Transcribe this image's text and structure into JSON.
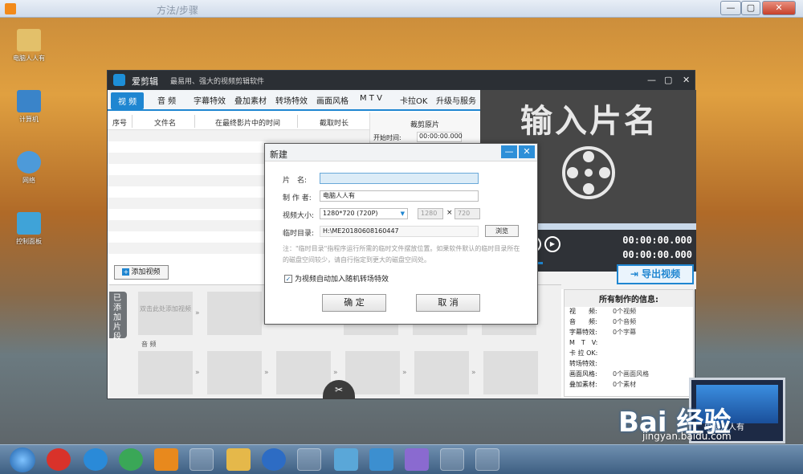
{
  "outer_window": {
    "blurred_title": "方法/步骤"
  },
  "desktop_icons": [
    "电脑人人有",
    "计算机",
    "网络",
    "控制面板"
  ],
  "app": {
    "name": "爱剪辑",
    "slogan": "最易用、强大的视频剪辑软件",
    "tabs": [
      "视 频",
      "音 频",
      "字幕特效",
      "叠加素材",
      "转场特效",
      "画面风格",
      "M T V",
      "卡拉OK",
      "升级与服务"
    ],
    "table_headers": [
      "序号",
      "文件名",
      "在最终影片中的时间",
      "截取时长"
    ],
    "cut_panel": {
      "title": "裁剪原片",
      "start_label": "开始时间:",
      "start_value": "00:00:00.000"
    },
    "preview_title": "输入片名",
    "timecodes": [
      "00:00:00.000",
      "00:00:00.000"
    ],
    "export_button": "导出视频",
    "add_video_button": "添加视频",
    "timeline": {
      "side_label": "已添加片段",
      "placeholder": "双击此处添加视频",
      "audio_label": "音 频"
    },
    "info": {
      "header": "所有制作的信息:",
      "rows": [
        {
          "k": "视　　频:",
          "v": "0个视频"
        },
        {
          "k": "音　　频:",
          "v": "0个音频"
        },
        {
          "k": "字幕特效:",
          "v": "0个字幕"
        },
        {
          "k": "M　T　V:",
          "v": ""
        },
        {
          "k": "卡 拉 OK:",
          "v": ""
        },
        {
          "k": "转场特效:",
          "v": ""
        },
        {
          "k": "画面风格:",
          "v": "0个画面风格"
        },
        {
          "k": "叠加素材:",
          "v": "0个素材"
        }
      ]
    }
  },
  "dialog": {
    "title": "新建",
    "name_label": "片　名:",
    "name_value": "",
    "author_label": "制 作 者:",
    "author_value": "电脑人人有",
    "size_label": "视频大小:",
    "size_value": "1280*720 (720P)",
    "width_value": "1280",
    "height_value": "720",
    "times_symbol": "×",
    "temp_label": "临时目录:",
    "temp_value": "H:\\ME20180608160447",
    "browse_button": "浏览",
    "note": "注：\"临时目录\"指程序运行所需的临时文件摆放位置。如果软件默认的临时目录所在的磁盘空间较少，请自行指定到更大的磁盘空间处。",
    "checkbox_label": "为视频自动加入随机转场特效",
    "checkbox_checked": true,
    "ok_button": "确 定",
    "cancel_button": "取 消"
  },
  "watermark": {
    "main": "Bai 经验",
    "sub": "jingyan.baidu.com",
    "laptop_text": "电脑人人有"
  }
}
